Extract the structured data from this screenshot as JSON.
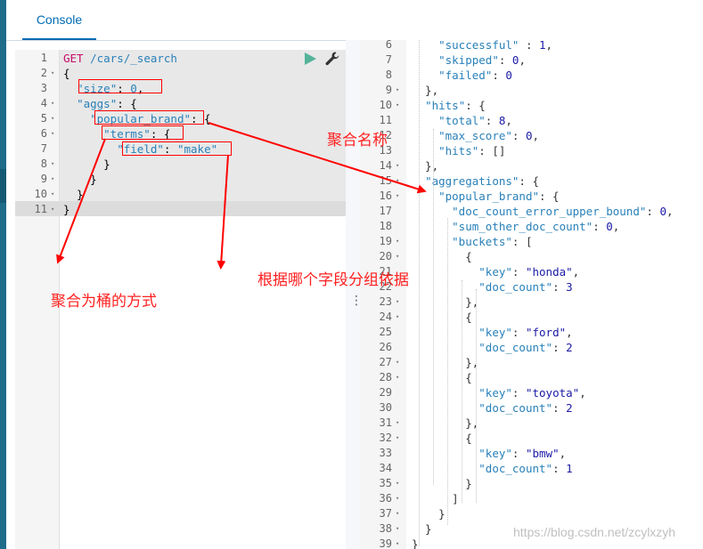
{
  "tab": {
    "label": "Console"
  },
  "request": {
    "lines": [
      {
        "n": "1",
        "fold": false,
        "text": ""
      },
      {
        "n": "2",
        "fold": true,
        "text": "{"
      },
      {
        "n": "3",
        "fold": false,
        "text": "  \"size\": 0,"
      },
      {
        "n": "4",
        "fold": true,
        "text": "  \"aggs\": {"
      },
      {
        "n": "5",
        "fold": true,
        "text": "    \"popular_brand\": {"
      },
      {
        "n": "6",
        "fold": true,
        "text": "      \"terms\": {"
      },
      {
        "n": "7",
        "fold": false,
        "text": "        \"field\": \"make\""
      },
      {
        "n": "8",
        "fold": true,
        "text": "      }"
      },
      {
        "n": "9",
        "fold": true,
        "text": "    }"
      },
      {
        "n": "10",
        "fold": true,
        "text": "  }"
      },
      {
        "n": "11",
        "fold": true,
        "text": "}"
      }
    ],
    "method": "GET",
    "url": "/cars/_search"
  },
  "response": {
    "lines": [
      {
        "n": "6",
        "fold": false,
        "text": "    \"successful\" : 1,"
      },
      {
        "n": "7",
        "fold": false,
        "text": "    \"skipped\": 0,"
      },
      {
        "n": "8",
        "fold": false,
        "text": "    \"failed\": 0"
      },
      {
        "n": "9",
        "fold": true,
        "text": "  },"
      },
      {
        "n": "10",
        "fold": true,
        "text": "  \"hits\": {"
      },
      {
        "n": "11",
        "fold": false,
        "text": "    \"total\": 8,"
      },
      {
        "n": "12",
        "fold": false,
        "text": "    \"max_score\": 0,"
      },
      {
        "n": "13",
        "fold": false,
        "text": "    \"hits\": []"
      },
      {
        "n": "14",
        "fold": true,
        "text": "  },"
      },
      {
        "n": "15",
        "fold": true,
        "text": "  \"aggregations\": {"
      },
      {
        "n": "16",
        "fold": true,
        "text": "    \"popular_brand\": {"
      },
      {
        "n": "17",
        "fold": false,
        "text": "      \"doc_count_error_upper_bound\": 0,"
      },
      {
        "n": "18",
        "fold": false,
        "text": "      \"sum_other_doc_count\": 0,"
      },
      {
        "n": "19",
        "fold": true,
        "text": "      \"buckets\": ["
      },
      {
        "n": "20",
        "fold": true,
        "text": "        {"
      },
      {
        "n": "21",
        "fold": false,
        "text": "          \"key\": \"honda\","
      },
      {
        "n": "22",
        "fold": false,
        "text": "          \"doc_count\": 3"
      },
      {
        "n": "23",
        "fold": true,
        "text": "        },"
      },
      {
        "n": "24",
        "fold": true,
        "text": "        {"
      },
      {
        "n": "25",
        "fold": false,
        "text": "          \"key\": \"ford\","
      },
      {
        "n": "26",
        "fold": false,
        "text": "          \"doc_count\": 2"
      },
      {
        "n": "27",
        "fold": true,
        "text": "        },"
      },
      {
        "n": "28",
        "fold": true,
        "text": "        {"
      },
      {
        "n": "29",
        "fold": false,
        "text": "          \"key\": \"toyota\","
      },
      {
        "n": "30",
        "fold": false,
        "text": "          \"doc_count\": 2"
      },
      {
        "n": "31",
        "fold": true,
        "text": "        },"
      },
      {
        "n": "32",
        "fold": true,
        "text": "        {"
      },
      {
        "n": "33",
        "fold": false,
        "text": "          \"key\": \"bmw\","
      },
      {
        "n": "34",
        "fold": false,
        "text": "          \"doc_count\": 1"
      },
      {
        "n": "35",
        "fold": true,
        "text": "        }"
      },
      {
        "n": "36",
        "fold": true,
        "text": "      ]"
      },
      {
        "n": "37",
        "fold": true,
        "text": "    }"
      },
      {
        "n": "38",
        "fold": true,
        "text": "  }"
      },
      {
        "n": "39",
        "fold": true,
        "text": "}"
      }
    ]
  },
  "annotations": {
    "agg_name": "聚合名称",
    "bucket_method": "聚合为桶的方式",
    "group_field": "根据哪个字段分组依据"
  },
  "watermark": "https://blog.csdn.net/zcylxzyh",
  "icons": {
    "run": "play-icon",
    "settings": "wrench-icon",
    "resize": "vertical-dots-icon"
  },
  "colors": {
    "accent": "#006bb4",
    "method": "#c80a68",
    "annotation": "#ff0000",
    "run": "#54b399"
  }
}
